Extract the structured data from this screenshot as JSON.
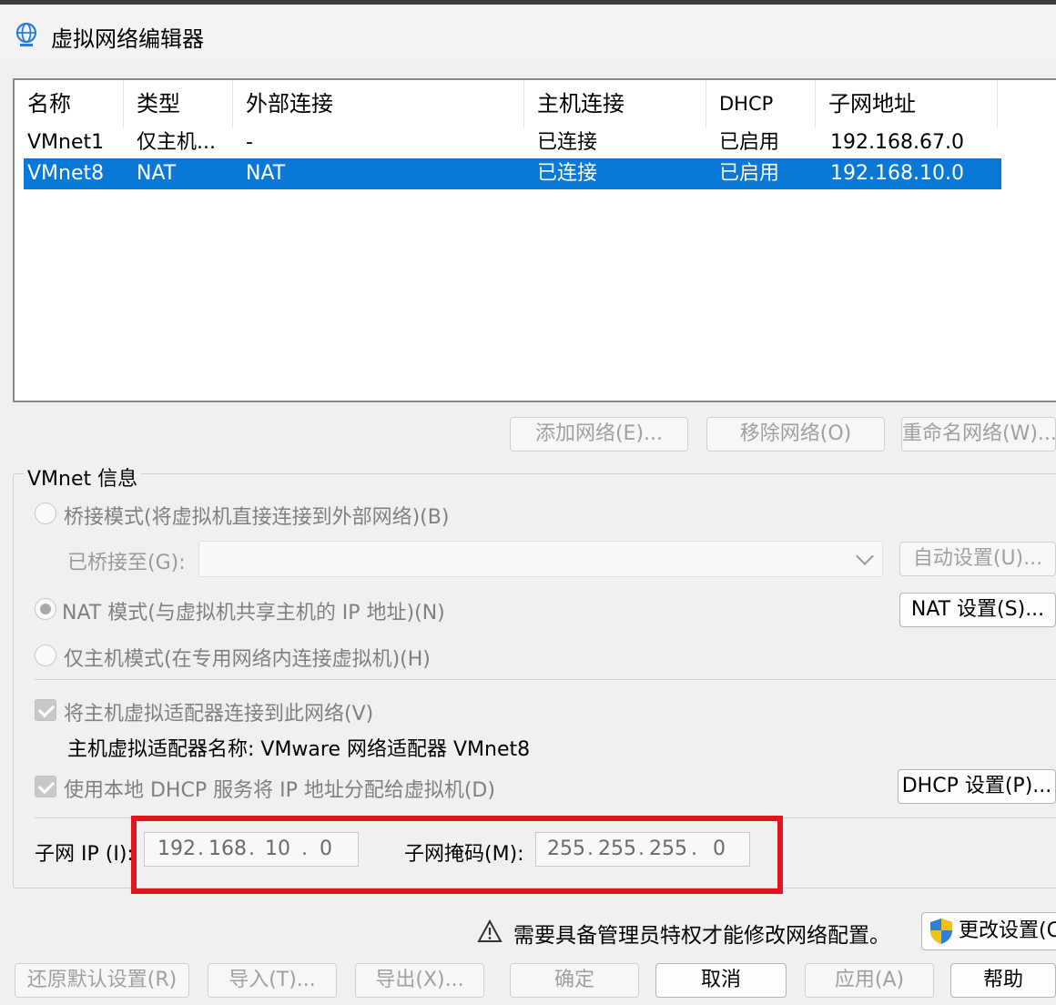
{
  "window": {
    "title": "虚拟网络编辑器"
  },
  "list": {
    "headers": [
      "名称",
      "类型",
      "外部连接",
      "主机连接",
      "DHCP",
      "子网地址"
    ],
    "rows": [
      {
        "name": "VMnet1",
        "type": "仅主机...",
        "external": "-",
        "host": "已连接",
        "dhcp": "已启用",
        "subnet": "192.168.67.0",
        "selected": false
      },
      {
        "name": "VMnet8",
        "type": "NAT",
        "external": "NAT",
        "host": "已连接",
        "dhcp": "已启用",
        "subnet": "192.168.10.0",
        "selected": true
      }
    ]
  },
  "list_buttons": {
    "add": "添加网络(E)...",
    "remove": "移除网络(O)",
    "rename": "重命名网络(W)..."
  },
  "vmnet_info": {
    "legend": "VMnet 信息",
    "bridge_label": "桥接模式(将虚拟机直接连接到外部网络)(B)",
    "bridged_to_label": "已桥接至(G):",
    "bridged_to_value": "",
    "auto_settings": "自动设置(U)...",
    "nat_label": "NAT 模式(与虚拟机共享主机的 IP 地址)(N)",
    "nat_settings": "NAT 设置(S)...",
    "hostonly_label": "仅主机模式(在专用网络内连接虚拟机)(H)",
    "connect_adapter_label": "将主机虚拟适配器连接到此网络(V)",
    "adapter_name_label": "主机虚拟适配器名称: VMware 网络适配器 VMnet8",
    "dhcp_label": "使用本地 DHCP 服务将 IP 地址分配给虚拟机(D)",
    "dhcp_settings": "DHCP 设置(P)...",
    "subnet_ip_label": "子网 IP (I):",
    "subnet_ip": [
      "192",
      "168",
      "10",
      "0"
    ],
    "subnet_mask_label": "子网掩码(M):",
    "subnet_mask": [
      "255",
      "255",
      "255",
      "0"
    ]
  },
  "warning": {
    "text": "需要具备管理员特权才能修改网络配置。",
    "change_settings": "更改设置(C)"
  },
  "footer": {
    "restore": "还原默认设置(R)",
    "import": "导入(T)...",
    "export": "导出(X)...",
    "ok": "确定",
    "cancel": "取消",
    "apply": "应用(A)",
    "help": "帮助"
  },
  "colors": {
    "selection": "#0a78d7",
    "highlight_border": "#e3141b",
    "background": "#f0f0f0"
  }
}
